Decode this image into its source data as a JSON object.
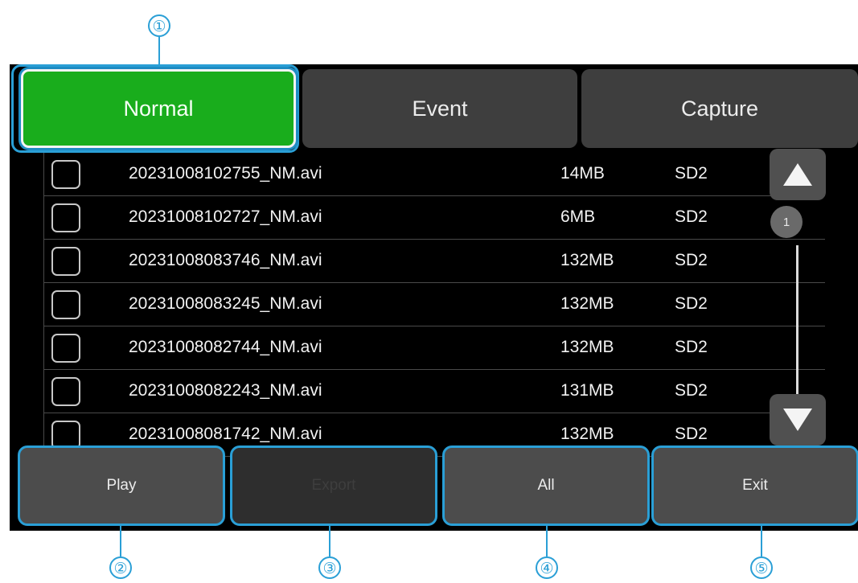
{
  "callouts": {
    "c1": "①",
    "c2": "②",
    "c3": "③",
    "c4": "④",
    "c5": "⑤"
  },
  "tabs": [
    {
      "label": "Normal",
      "active": true
    },
    {
      "label": "Event",
      "active": false
    },
    {
      "label": "Capture",
      "active": false
    }
  ],
  "files": [
    {
      "name": "20231008102755_NM.avi",
      "size": "14MB",
      "device": "SD2"
    },
    {
      "name": "20231008102727_NM.avi",
      "size": "6MB",
      "device": "SD2"
    },
    {
      "name": "20231008083746_NM.avi",
      "size": "132MB",
      "device": "SD2"
    },
    {
      "name": "20231008083245_NM.avi",
      "size": "132MB",
      "device": "SD2"
    },
    {
      "name": "20231008082744_NM.avi",
      "size": "132MB",
      "device": "SD2"
    },
    {
      "name": "20231008082243_NM.avi",
      "size": "131MB",
      "device": "SD2"
    },
    {
      "name": "20231008081742_NM.avi",
      "size": "132MB",
      "device": "SD2"
    }
  ],
  "scrollbar": {
    "page": "1",
    "up_icon": "triangle-up-icon",
    "down_icon": "triangle-down-icon"
  },
  "buttons": {
    "play": "Play",
    "export": "Export",
    "all": "All",
    "exit": "Exit"
  },
  "colors": {
    "active_tab": "#19ad1c",
    "highlight": "#2a9fd6",
    "tab_bg": "#3e3e3e",
    "screen_bg": "#000000"
  }
}
